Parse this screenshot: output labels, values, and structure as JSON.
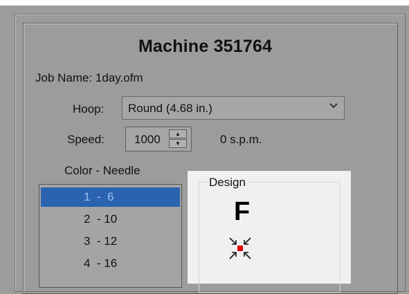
{
  "machine": {
    "title": "Machine 351764",
    "job_name_label": "Job Name: 1day.ofm",
    "hoop_label": "Hoop:",
    "hoop_value": "Round (4.68 in.)",
    "speed_label": "Speed:",
    "speed_value": "1000",
    "spm_text": "0 s.p.m.",
    "color_needle_label": "Color - Needle",
    "color_needle_items": [
      {
        "text": "1  -  6",
        "selected": true
      },
      {
        "text": "2  - 10",
        "selected": false
      },
      {
        "text": "3  - 12",
        "selected": false
      },
      {
        "text": "4  - 16",
        "selected": false
      }
    ]
  },
  "design": {
    "legend": "Design",
    "letter": "F"
  },
  "icons": {
    "hoop_dropdown": "chevron-down-icon",
    "speed_up": "spin-up-icon",
    "speed_down": "spin-down-icon",
    "design_center": "compress-arrows-icon"
  },
  "colors": {
    "selection": "#2b63b0",
    "panel_bg": "#9c9c9c",
    "design_marker": "#e00000"
  }
}
